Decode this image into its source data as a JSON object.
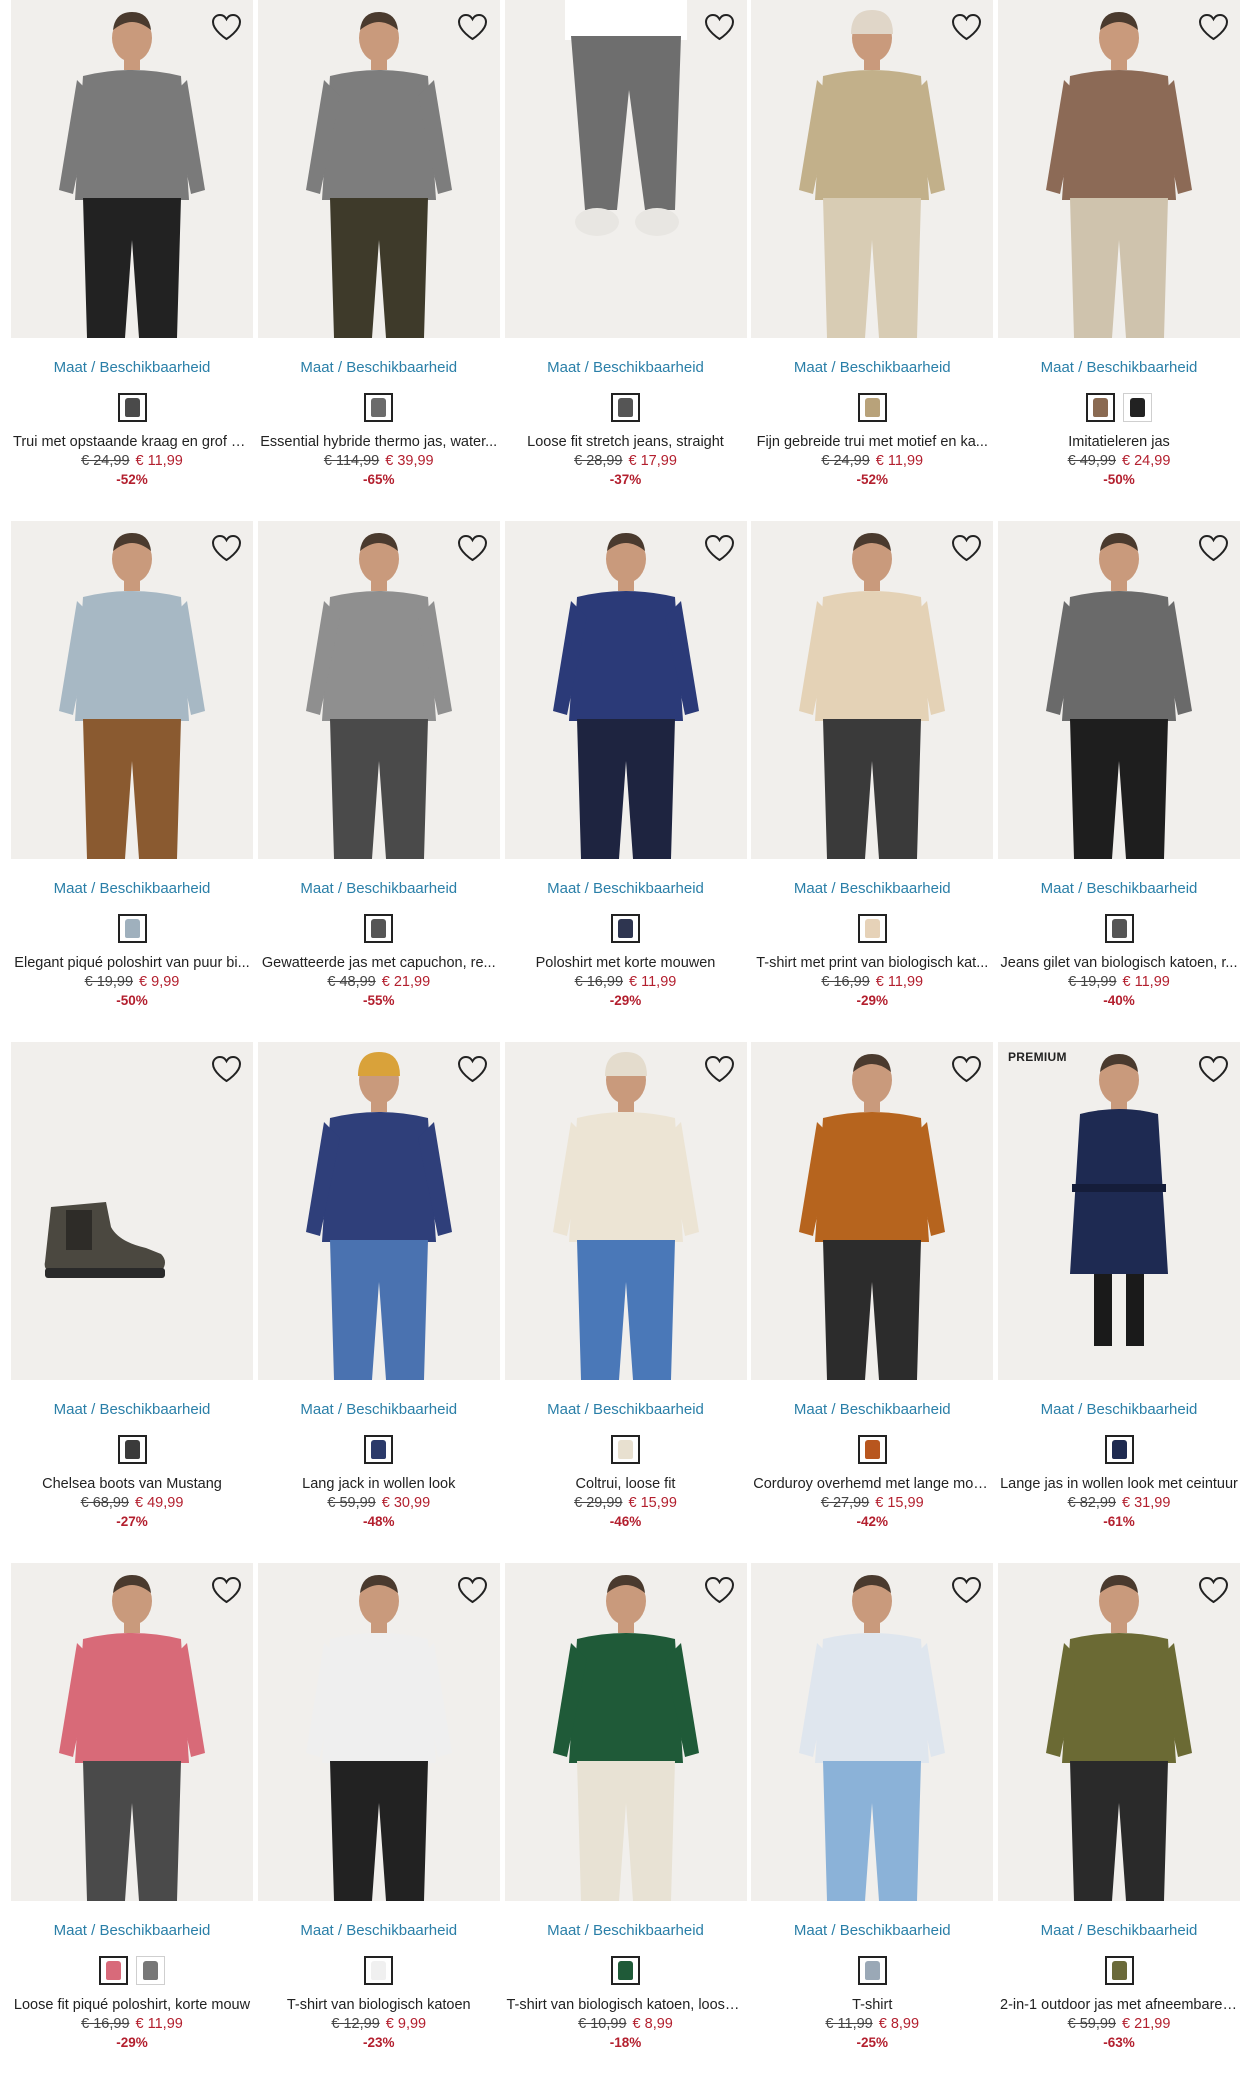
{
  "labels": {
    "size_link": "Maat / Beschikbaarheid"
  },
  "colors": {
    "link": "#2a7fa8",
    "sale_price": "#b31f2e",
    "background": "#ffffff"
  },
  "products": [
    {
      "name": "Trui met opstaande kraag en grof p...",
      "old_price": "€ 24,99",
      "new_price": "€ 11,99",
      "discount": "-52%",
      "swatches": [
        "#4a4a4a"
      ],
      "badge": "",
      "figure": {
        "kind": "person",
        "top": "#7a7a7a",
        "bottom": "#222222",
        "hat": ""
      }
    },
    {
      "name": "Essential hybride thermo jas, water...",
      "old_price": "€ 114,99",
      "new_price": "€ 39,99",
      "discount": "-65%",
      "swatches": [
        "#6b6b6b"
      ],
      "badge": "",
      "figure": {
        "kind": "person",
        "top": "#7d7d7d",
        "bottom": "#3e3a2a",
        "hat": ""
      }
    },
    {
      "name": "Loose fit stretch jeans, straight",
      "old_price": "€ 28,99",
      "new_price": "€ 17,99",
      "discount": "-37%",
      "swatches": [
        "#555555"
      ],
      "badge": "",
      "figure": {
        "kind": "legs",
        "top": "#ffffff",
        "bottom": "#6e6e6e",
        "hat": ""
      }
    },
    {
      "name": "Fijn gebreide trui met motief en ka...",
      "old_price": "€ 24,99",
      "new_price": "€ 11,99",
      "discount": "-52%",
      "swatches": [
        "#b8a27a"
      ],
      "badge": "",
      "figure": {
        "kind": "person",
        "top": "#c2b08a",
        "bottom": "#d8ccb4",
        "hat": "#e0d6c8"
      }
    },
    {
      "name": "Imitatieleren jas",
      "old_price": "€ 49,99",
      "new_price": "€ 24,99",
      "discount": "-50%",
      "swatches": [
        "#8a6a52",
        "#222222"
      ],
      "badge": "",
      "figure": {
        "kind": "person",
        "top": "#8c6a56",
        "bottom": "#cfc3ad",
        "hat": ""
      }
    },
    {
      "name": "Elegant piqué poloshirt van puur bi...",
      "old_price": "€ 19,99",
      "new_price": "€ 9,99",
      "discount": "-50%",
      "swatches": [
        "#9fb0bd"
      ],
      "badge": "",
      "figure": {
        "kind": "person",
        "top": "#a7b8c4",
        "bottom": "#8a5a30",
        "hat": ""
      }
    },
    {
      "name": "Gewatteerde jas met capuchon, re...",
      "old_price": "€ 48,99",
      "new_price": "€ 21,99",
      "discount": "-55%",
      "swatches": [
        "#555555"
      ],
      "badge": "",
      "figure": {
        "kind": "person",
        "top": "#8f8f8f",
        "bottom": "#4a4a4a",
        "hat": ""
      }
    },
    {
      "name": "Poloshirt met korte mouwen",
      "old_price": "€ 16,99",
      "new_price": "€ 11,99",
      "discount": "-29%",
      "swatches": [
        "#2e3550"
      ],
      "badge": "",
      "figure": {
        "kind": "person",
        "top": "#2b3a78",
        "bottom": "#1e2440",
        "hat": ""
      }
    },
    {
      "name": "T-shirt met print van biologisch kat...",
      "old_price": "€ 16,99",
      "new_price": "€ 11,99",
      "discount": "-29%",
      "swatches": [
        "#e6d2b8"
      ],
      "badge": "",
      "figure": {
        "kind": "person",
        "top": "#e4d2b6",
        "bottom": "#3a3a3a",
        "hat": ""
      }
    },
    {
      "name": "Jeans gilet van biologisch katoen, r...",
      "old_price": "€ 19,99",
      "new_price": "€ 11,99",
      "discount": "-40%",
      "swatches": [
        "#555555"
      ],
      "badge": "",
      "figure": {
        "kind": "person",
        "top": "#6a6a6a",
        "bottom": "#1e1e1e",
        "hat": ""
      }
    },
    {
      "name": "Chelsea boots van Mustang",
      "old_price": "€ 68,99",
      "new_price": "€ 49,99",
      "discount": "-27%",
      "swatches": [
        "#3a3a3a"
      ],
      "badge": "",
      "figure": {
        "kind": "boot",
        "top": "#4b4840",
        "bottom": "#2a2a2a",
        "hat": ""
      }
    },
    {
      "name": "Lang jack in wollen look",
      "old_price": "€ 59,99",
      "new_price": "€ 30,99",
      "discount": "-48%",
      "swatches": [
        "#2b3a6a"
      ],
      "badge": "",
      "figure": {
        "kind": "person",
        "top": "#2f3f7a",
        "bottom": "#4a72b0",
        "hat": "#d9a23a"
      }
    },
    {
      "name": "Coltrui, loose fit",
      "old_price": "€ 29,99",
      "new_price": "€ 15,99",
      "discount": "-46%",
      "swatches": [
        "#e8e0d0"
      ],
      "badge": "",
      "figure": {
        "kind": "person",
        "top": "#ece4d4",
        "bottom": "#4a78b8",
        "hat": "#e4dccd"
      }
    },
    {
      "name": "Corduroy overhemd met lange mou...",
      "old_price": "€ 27,99",
      "new_price": "€ 15,99",
      "discount": "-42%",
      "swatches": [
        "#b8561e"
      ],
      "badge": "",
      "figure": {
        "kind": "person",
        "top": "#b6641e",
        "bottom": "#2c2c2c",
        "hat": ""
      }
    },
    {
      "name": "Lange jas in wollen look met ceintuur",
      "old_price": "€ 82,99",
      "new_price": "€ 31,99",
      "discount": "-61%",
      "swatches": [
        "#1e2a50"
      ],
      "badge": "PREMIUM",
      "figure": {
        "kind": "coat",
        "top": "#1e2a52",
        "bottom": "#1a1a1a",
        "hat": ""
      }
    },
    {
      "name": "Loose fit piqué poloshirt, korte mouw",
      "old_price": "€ 16,99",
      "new_price": "€ 11,99",
      "discount": "-29%",
      "swatches": [
        "#d86a7a",
        "#777777"
      ],
      "badge": "",
      "figure": {
        "kind": "person",
        "top": "#d86a78",
        "bottom": "#4a4a4a",
        "hat": ""
      }
    },
    {
      "name": "T-shirt van biologisch katoen",
      "old_price": "€ 12,99",
      "new_price": "€ 9,99",
      "discount": "-23%",
      "swatches": [
        "#f0f0f0"
      ],
      "badge": "",
      "figure": {
        "kind": "person",
        "top": "#efefef",
        "bottom": "#222222",
        "hat": ""
      }
    },
    {
      "name": "T-shirt van biologisch katoen, loose ...",
      "old_price": "€ 10,99",
      "new_price": "€ 8,99",
      "discount": "-18%",
      "swatches": [
        "#1f5a38"
      ],
      "badge": "",
      "figure": {
        "kind": "person",
        "top": "#1f5a38",
        "bottom": "#e8e2d4",
        "hat": ""
      }
    },
    {
      "name": "T-shirt",
      "old_price": "€ 11,99",
      "new_price": "€ 8,99",
      "discount": "-25%",
      "swatches": [
        "#9aa8b6"
      ],
      "badge": "",
      "figure": {
        "kind": "person",
        "top": "#dfe6ee",
        "bottom": "#8bb2d8",
        "hat": ""
      }
    },
    {
      "name": "2-in-1 outdoor jas met afneembare ...",
      "old_price": "€ 59,99",
      "new_price": "€ 21,99",
      "discount": "-63%",
      "swatches": [
        "#6b6a3a"
      ],
      "badge": "",
      "figure": {
        "kind": "person",
        "top": "#6b6a34",
        "bottom": "#2a2a2a",
        "hat": ""
      }
    }
  ]
}
